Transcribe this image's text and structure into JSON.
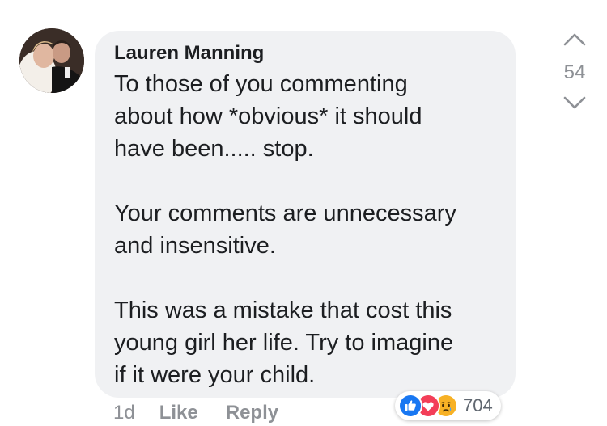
{
  "comment": {
    "author": "Lauren Manning",
    "lines": [
      "To those of you commenting",
      "about how *obvious* it should",
      "have been..... stop.",
      "",
      "Your comments are unnecessary",
      "and insensitive.",
      "",
      "This was a mistake that cost this",
      "young girl her life. Try to imagine",
      "if it were your child."
    ]
  },
  "vote": {
    "count": "54",
    "up_icon": "chevron-up-icon",
    "down_icon": "chevron-down-icon"
  },
  "footer": {
    "time": "1d",
    "like_label": "Like",
    "reply_label": "Reply"
  },
  "reactions": {
    "icons": [
      "like-reaction-icon",
      "love-reaction-icon",
      "sad-reaction-icon"
    ],
    "count": "704"
  },
  "colors": {
    "bubble_bg": "#f0f1f3",
    "text": "#1c1e21",
    "meta": "#8e9196",
    "like_blue": "#1877f2",
    "love_red": "#f33e58",
    "sad_yellow": "#f7b125"
  }
}
